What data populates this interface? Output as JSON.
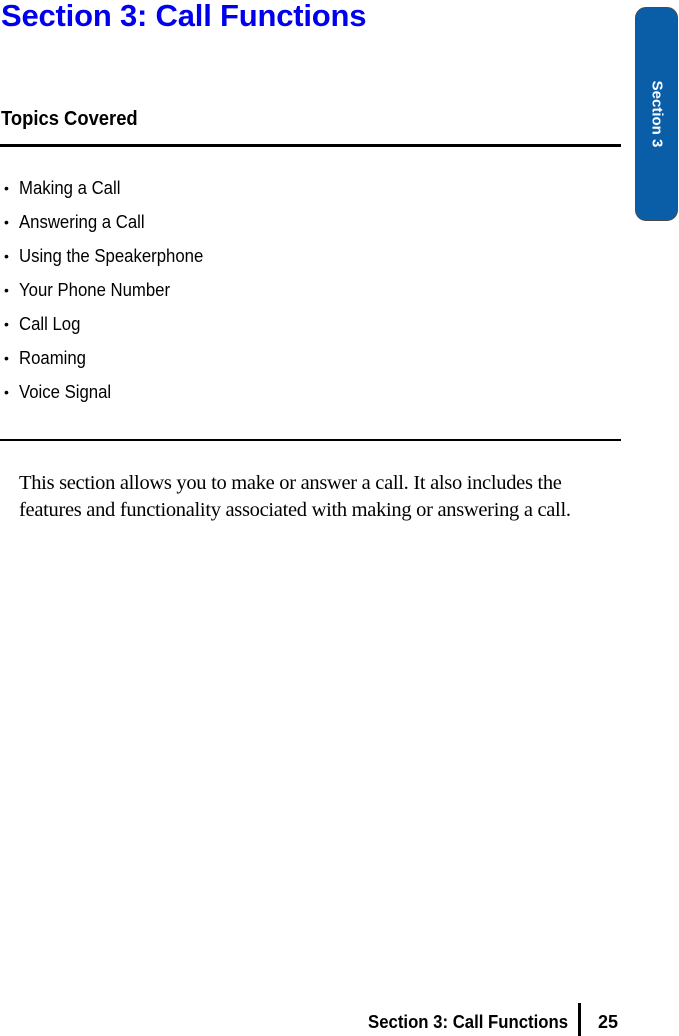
{
  "page": {
    "title": "Section 3: Call Functions",
    "side_tab": {
      "label": "Section 3",
      "color": "#0a5ea8"
    },
    "title_color": "#0000ee"
  },
  "topics": {
    "heading": "Topics Covered",
    "bullet": "•",
    "items": [
      {
        "label": "Making a Call"
      },
      {
        "label": "Answering a Call"
      },
      {
        "label": "Using the Speakerphone"
      },
      {
        "label": "Your Phone Number"
      },
      {
        "label": "Call Log"
      },
      {
        "label": "Roaming"
      },
      {
        "label": "Voice Signal"
      }
    ]
  },
  "body": {
    "intro": "This section allows you to make or answer a call. It also includes the features and functionality associated with making or answering a call."
  },
  "footer": {
    "section_title": "Section 3: Call Functions",
    "page_number": "25"
  }
}
